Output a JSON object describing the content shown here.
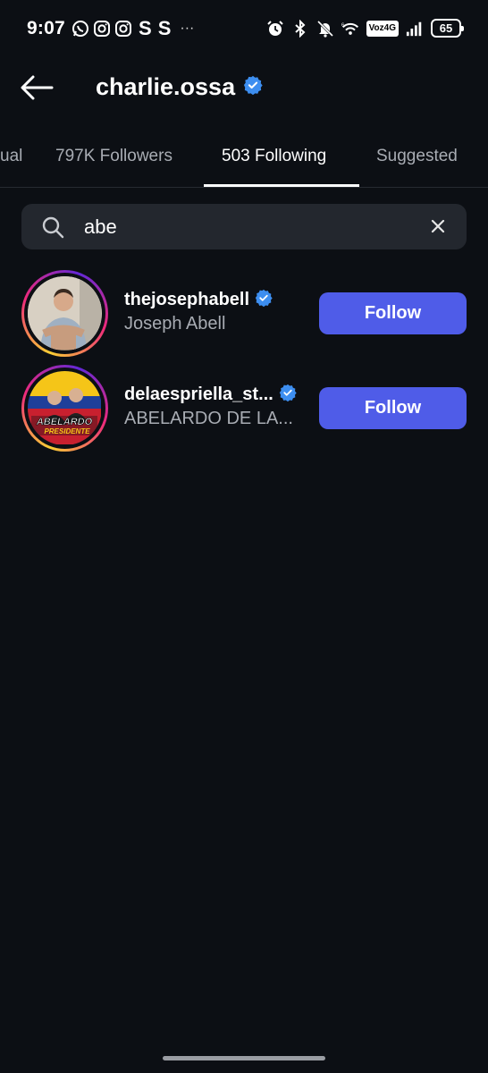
{
  "status_bar": {
    "time": "9:07",
    "app_letters": [
      "S",
      "S"
    ],
    "overflow_dots": "···",
    "network_badge": "Voz4G",
    "signal_label": "6",
    "battery_level": "65"
  },
  "header": {
    "title": "charlie.ossa",
    "verified": true
  },
  "tabs": [
    {
      "label": "ual",
      "active": false
    },
    {
      "label": "797K Followers",
      "active": false
    },
    {
      "label": "503 Following",
      "active": true
    },
    {
      "label": "Suggested",
      "active": false
    }
  ],
  "search": {
    "value": "abe",
    "placeholder": "Search"
  },
  "results": [
    {
      "username": "thejosephabell",
      "full_name": "Joseph Abell",
      "verified": true,
      "button_label": "Follow"
    },
    {
      "username": "delaespriella_st...",
      "full_name": "ABELARDO DE LA...",
      "verified": true,
      "button_label": "Follow",
      "avatar_text": [
        "ABELARDO",
        "PRESIDENTE"
      ]
    }
  ],
  "colors": {
    "background": "#0c0f14",
    "follow_button": "#4f5ce8",
    "verified_badge": "#3d8ef0",
    "search_bg": "#23272e"
  }
}
